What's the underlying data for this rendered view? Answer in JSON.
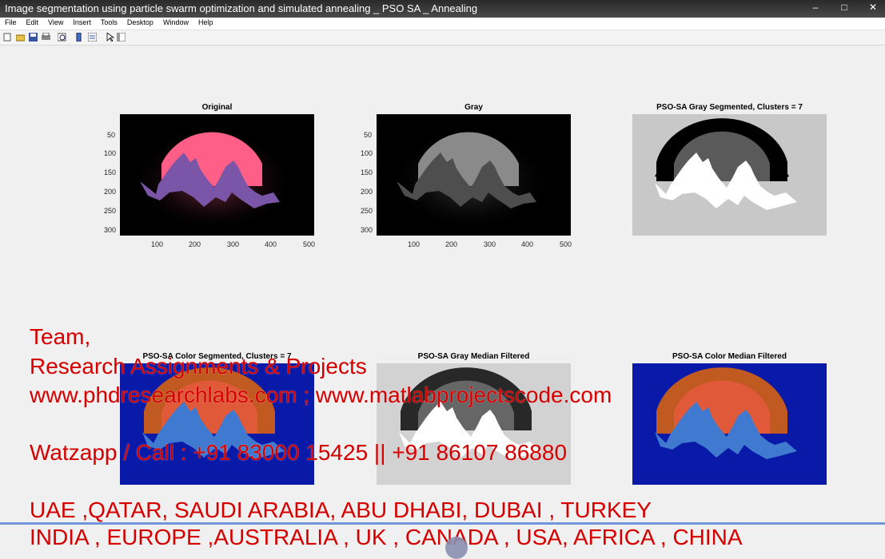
{
  "window": {
    "title": "Image segmentation using particle swarm optimization and simulated annealing _ PSO SA _ Annealing",
    "buttons": [
      "–",
      "□",
      "✕"
    ]
  },
  "menu": [
    "File",
    "Edit",
    "View",
    "Insert",
    "Tools",
    "Desktop",
    "Window",
    "Help"
  ],
  "toolbar_icons": [
    "new-figure-icon",
    "open-file-icon",
    "save-icon",
    "print-icon",
    "print-preview-icon",
    "colorbar-icon",
    "legend-icon",
    "pointer-icon",
    "property-editor-icon"
  ],
  "axes": [
    {
      "title": "Original",
      "xticks": [
        "100",
        "200",
        "300",
        "400",
        "500"
      ],
      "yticks": [
        "50",
        "100",
        "150",
        "200",
        "250",
        "300"
      ]
    },
    {
      "title": "Gray",
      "xticks": [
        "100",
        "200",
        "300",
        "400",
        "500"
      ],
      "yticks": [
        "50",
        "100",
        "150",
        "200",
        "250",
        "300"
      ]
    },
    {
      "title": "PSO-SA Gray Segmented, Clusters = 7"
    },
    {
      "title": "PSO-SA Color Segmented, Clusters = 7"
    },
    {
      "title": "PSO-SA Gray Median Filtered"
    },
    {
      "title": "PSO-SA Color Median Filtered"
    }
  ],
  "overlay": {
    "line1": "Team,",
    "line2": "Research Assignments & Projects",
    "line3": "www.phdresearchlabs.com ; www.matlabprojectscode.com",
    "line4": "Watzapp / Call : +91 83000 15425 || +91 86107 86880",
    "line5": "UAE ,QATAR, SAUDI ARABIA, ABU DHABI, DUBAI , TURKEY",
    "line6": "INDIA , EUROPE ,AUSTRALIA , UK , CANADA , USA, AFRICA , CHINA"
  }
}
